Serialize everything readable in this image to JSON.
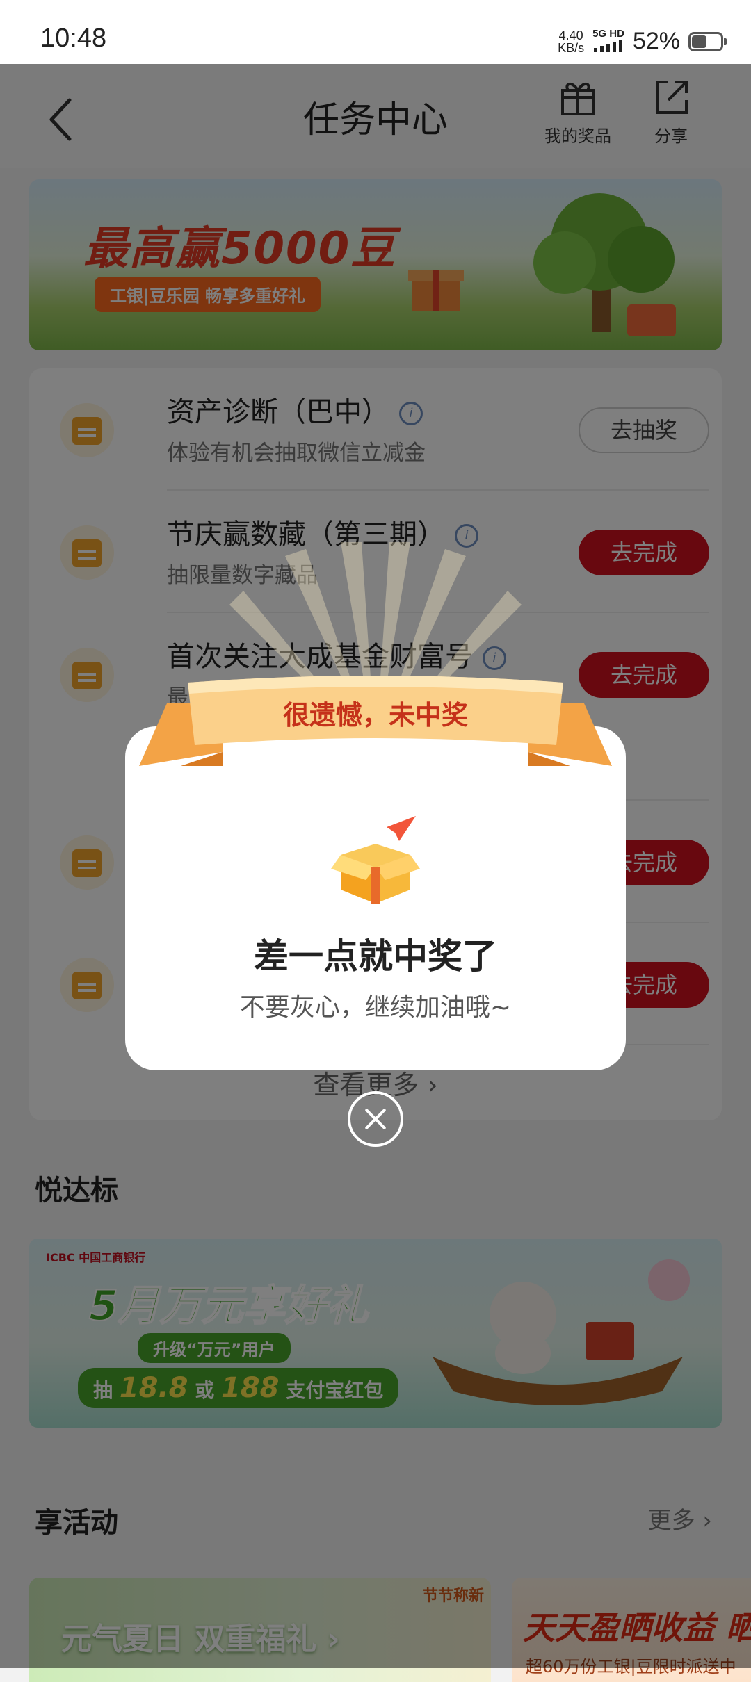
{
  "status_bar": {
    "time": "10:48",
    "speed_value": "4.40",
    "speed_unit": "KB/s",
    "network": "5G HD",
    "battery": "52%",
    "battery_level": 0.52
  },
  "header": {
    "title": "任务中心",
    "prizes_label": "我的奖品",
    "share_label": "分享"
  },
  "top_banner": {
    "title": "最高赢5000豆",
    "subtitle": "工银|豆乐园 畅享多重好礼"
  },
  "tasks": [
    {
      "title": "资产诊断（巴中）",
      "subtitle": "体验有机会抽取微信立减金",
      "button": "去抽奖",
      "button_style": "outline"
    },
    {
      "title": "节庆赢数藏（第三期）",
      "subtitle": "抽限量数字藏品",
      "button": "去完成",
      "button_style": "red"
    },
    {
      "title": "首次关注大成基金财富号",
      "subtitle": "最高",
      "button": "去完成",
      "button_style": "red"
    },
    {
      "title": "",
      "subtitle": "",
      "button": "去完成",
      "button_style": "red"
    },
    {
      "title": "",
      "subtitle": "",
      "button": "去完成",
      "button_style": "red"
    }
  ],
  "see_more": "查看更多 ›",
  "section_yuedabiao": {
    "title": "悦达标"
  },
  "mid_banner": {
    "bank": "ICBC 中国工商银行",
    "title": "5月万元享好礼",
    "pill1": "升级“万元”用户",
    "pill2_prefix": "抽",
    "amount1": "18.8",
    "pill2_mid": "或",
    "amount2": "188",
    "pill2_suffix": "支付宝红包"
  },
  "section_activity": {
    "title": "享活动",
    "more": "更多 ›"
  },
  "activities": [
    {
      "title": "元气夏日 双重福礼 ›",
      "tag": "节节称新"
    },
    {
      "title": "天天盈晒收益 晒",
      "subtitle": "超60万份工银|豆限时派送中"
    }
  ],
  "modal": {
    "ribbon": "很遗憾，未中奖",
    "title": "差一点就中奖了",
    "subtitle": "不要灰心，继续加油哦~"
  },
  "colors": {
    "brand_red": "#d0101e",
    "ribbon_orange": "#f5b25a",
    "overlay": "rgba(0,0,0,0.5)"
  }
}
